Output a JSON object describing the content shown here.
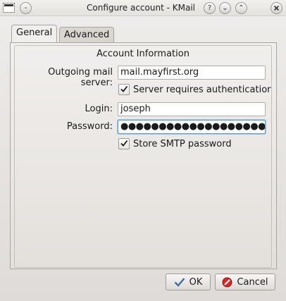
{
  "window": {
    "title": "Configure account - KMail",
    "help_glyph": "?",
    "minimize_glyph": "⌄",
    "maximize_glyph": "⌃",
    "options_glyph": "-"
  },
  "tabs": [
    {
      "label": "General"
    },
    {
      "label": "Advanced"
    }
  ],
  "group": {
    "title": "Account Information"
  },
  "form": {
    "server_label": "Outgoing mail server:",
    "server_value": "mail.mayfirst.org",
    "auth_label": "Server requires authenticatior",
    "auth_checked": true,
    "login_label": "Login:",
    "login_value": "joseph",
    "password_label": "Password:",
    "password_value": "●●●●●●●●●●●●●●●●●●●",
    "store_label": "Store SMTP password",
    "store_checked": true
  },
  "buttons": {
    "ok_label": "OK",
    "cancel_label": "Cancel"
  },
  "colors": {
    "focus_border": "#5b9bd1",
    "ok_icon": "#3a6ea5",
    "cancel_icon": "#d0282b"
  }
}
